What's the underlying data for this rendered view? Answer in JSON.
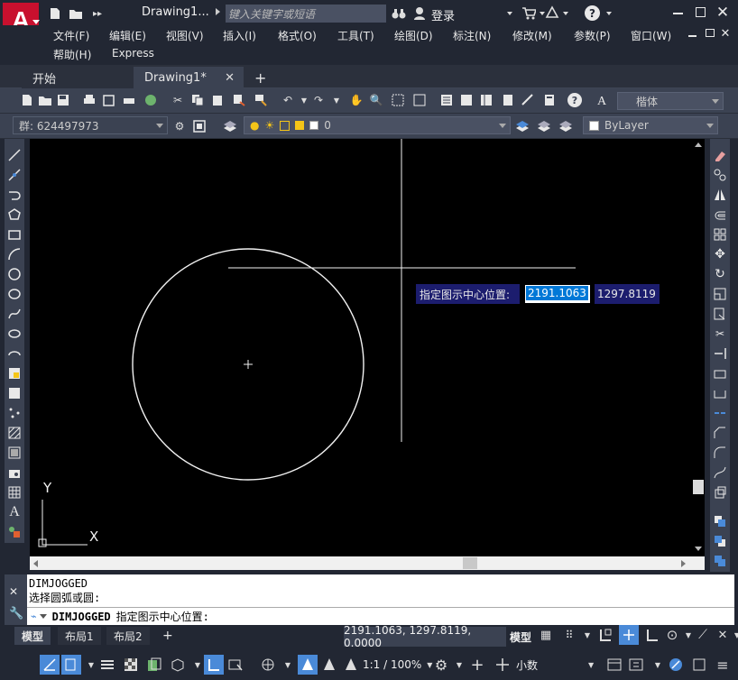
{
  "title_bar": {
    "document_title": "Drawing1...",
    "search_placeholder": "键入关键字或短语",
    "login_label": "登录"
  },
  "menu": {
    "row1": [
      "文件(F)",
      "编辑(E)",
      "视图(V)",
      "插入(I)",
      "格式(O)",
      "工具(T)",
      "绘图(D)",
      "标注(N)",
      "修改(M)",
      "参数(P)",
      "窗口(W)"
    ],
    "row2": [
      "帮助(H)",
      "Express"
    ]
  },
  "tabs": {
    "start": "开始",
    "drawing": "Drawing1*"
  },
  "toolbar1": {
    "text_style": "楷体"
  },
  "toolbar2": {
    "group_combo": "群: 624497973",
    "layer_name": "0",
    "color_combo": "ByLayer"
  },
  "canvas": {
    "prompt_label": "指定图示中心位置:",
    "x_input": "2191.1063",
    "y_value": "1297.8119",
    "ucs_x": "X",
    "ucs_y": "Y"
  },
  "command_line": {
    "history_line1": "DIMJOGGED",
    "history_line2": "选择圆弧或圆:",
    "current_command": "DIMJOGGED",
    "current_prompt": "指定图示中心位置:"
  },
  "layout_tabs": [
    "模型",
    "布局1",
    "布局2"
  ],
  "status": {
    "coordinates": "2191.1063, 1297.8119, 0.0000",
    "model_label": "模型",
    "scale_label": "1:1 / 100%",
    "units_label": "小数"
  }
}
